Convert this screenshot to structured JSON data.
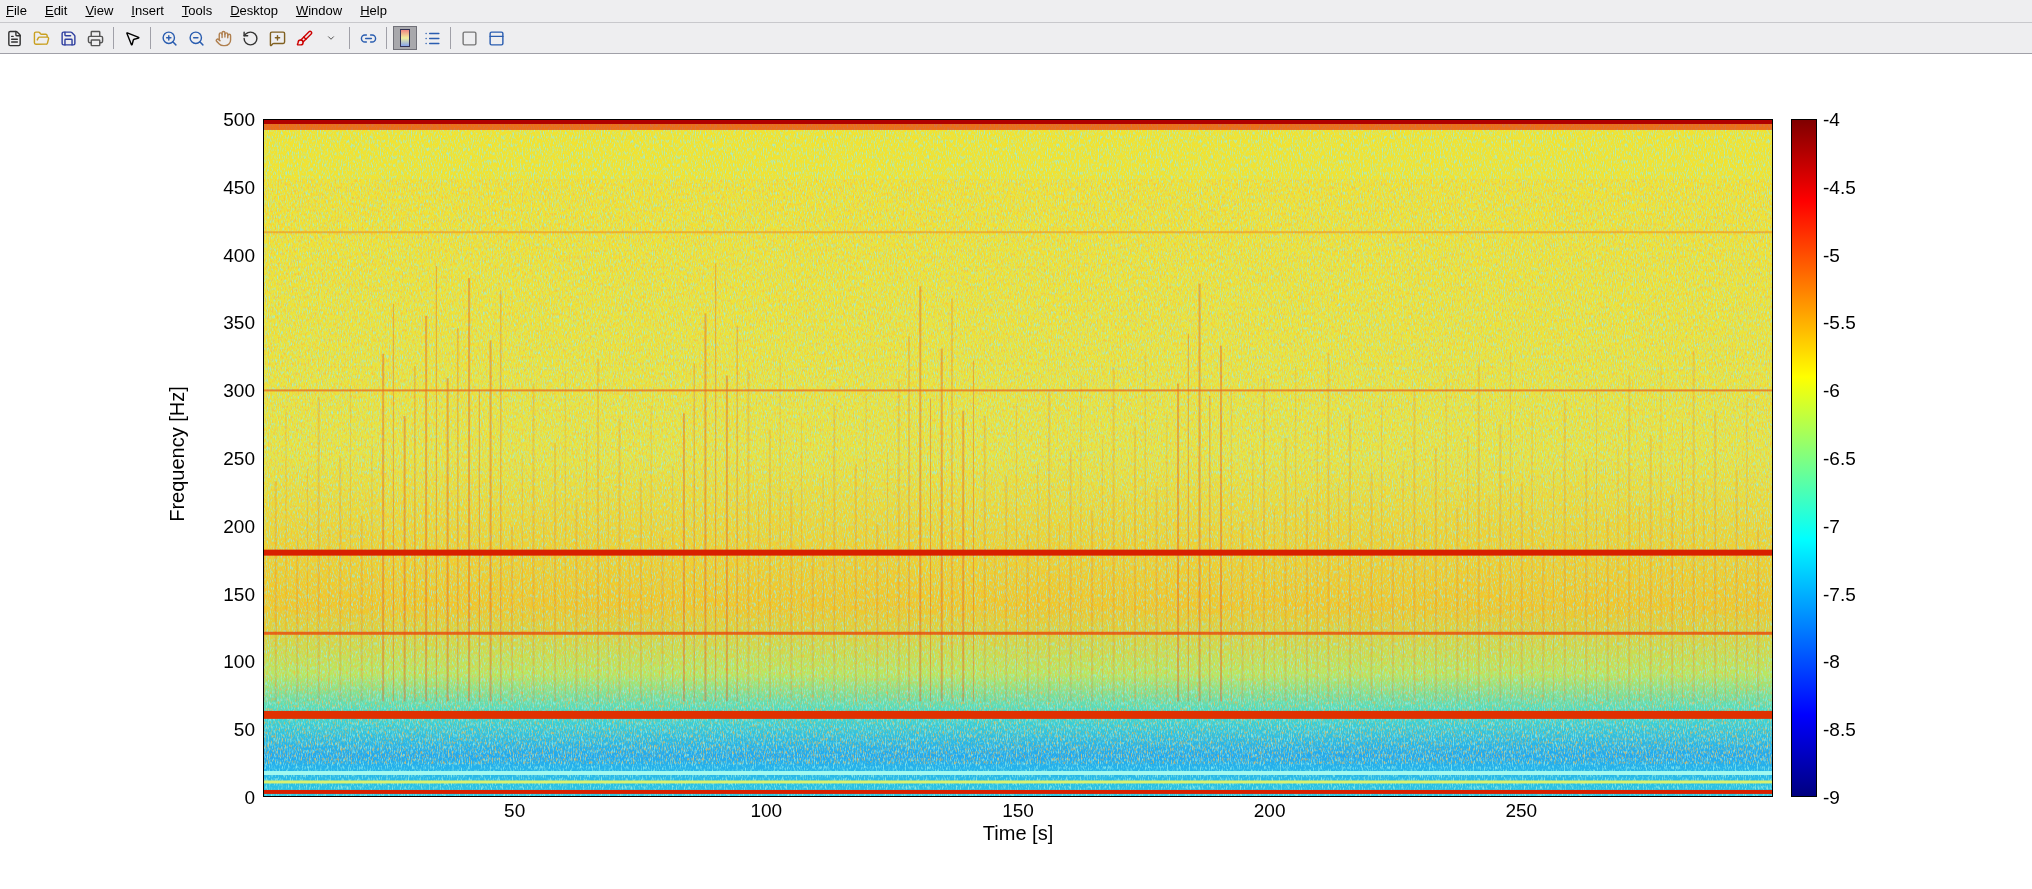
{
  "menu": [
    "File",
    "Edit",
    "View",
    "Insert",
    "Tools",
    "Desktop",
    "Window",
    "Help"
  ],
  "toolbar": [
    {
      "selected": false
    },
    {
      "selected": false
    },
    {
      "selected": false
    },
    {
      "selected": false
    },
    {
      "selected": false
    },
    {
      "selected": false
    },
    {
      "selected": false
    },
    {
      "selected": false
    },
    {
      "selected": false
    },
    {
      "selected": false
    },
    {
      "selected": false
    },
    {
      "selected": false
    },
    {
      "selected": false
    },
    {
      "selected": true
    },
    {
      "selected": false
    },
    {
      "selected": false
    },
    {
      "selected": false
    }
  ],
  "plot": {
    "xlabel": "Time [s]",
    "ylabel": "Frequency [Hz]",
    "xticks": [
      "50",
      "100",
      "150",
      "200",
      "250"
    ],
    "yticks": [
      "500",
      "450",
      "400",
      "350",
      "300",
      "250",
      "200",
      "150",
      "100",
      "50",
      "0"
    ]
  },
  "colorbar": {
    "ticks": [
      "-4",
      "-4.5",
      "-5",
      "-5.5",
      "-6",
      "-6.5",
      "-7",
      "-7.5",
      "-8",
      "-8.5",
      "-9"
    ]
  }
}
